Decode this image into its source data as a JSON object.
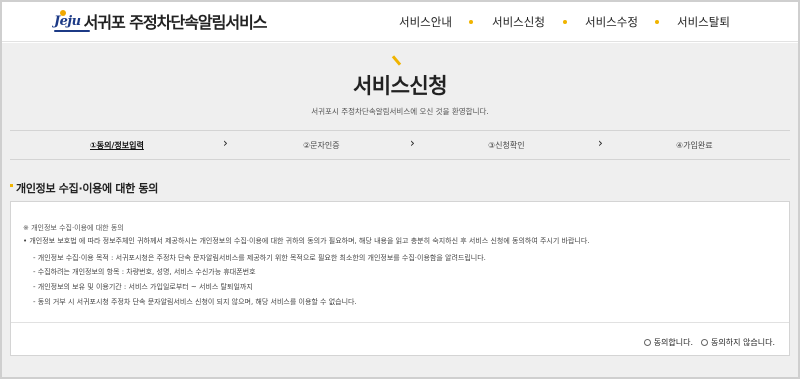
{
  "header": {
    "logo_mark": "Jeju",
    "logo_text": "서귀포 주정차단속알림서비스",
    "nav": [
      {
        "label": "서비스안내"
      },
      {
        "label": "서비스신청"
      },
      {
        "label": "서비스수정"
      },
      {
        "label": "서비스탈퇴"
      }
    ]
  },
  "hero": {
    "title": "서비스신청",
    "subtitle": "서귀포시 주정차단속알림서비스에 오신 것을 환영합니다."
  },
  "steps": [
    {
      "label": "①동의/정보입력",
      "active": true
    },
    {
      "label": "②문자인증",
      "active": false
    },
    {
      "label": "③신청확인",
      "active": false
    },
    {
      "label": "④가입완료",
      "active": false
    }
  ],
  "section": {
    "title": "개인정보 수집·이용에 대한 동의"
  },
  "consent": {
    "heading": "※ 개인정보 수집·이용에 대한 동의",
    "intro": "• 개인정보 보호법 에 따라 정보주체인 귀하께서 제공하시는 개인정보의 수집·이용에 대한 귀하의 동의가 필요하며, 해당 내용을 읽고 충분히 숙지하신 후 서비스 신청에 동의하여 주시기 바랍니다.",
    "items": [
      "- 개인정보 수집·이용 목적 : 서귀포시청은 주정차 단속 문자알림서비스를 제공하기 위한 목적으로 필요한 최소한의 개인정보를 수집·이용함을 알려드립니다.",
      "- 수집하려는 개인정보의 항목 : 차량번호, 성명, 서비스 수신가능 휴대폰번호",
      "- 개인정보의 보유 및 이용기간 : 서비스 가입일로부터 ~ 서비스 탈퇴일까지",
      "- 동의 거부 시 서귀포시청 주정차 단속 문자알림서비스 신청이 되지 않으며, 해당 서비스를 이용할 수 없습니다."
    ],
    "agree_label": "동의합니다.",
    "disagree_label": "동의하지 않습니다."
  },
  "colors": {
    "accent": "#f0b400",
    "background": "#efefef",
    "logo_blue": "#1c3a86"
  }
}
